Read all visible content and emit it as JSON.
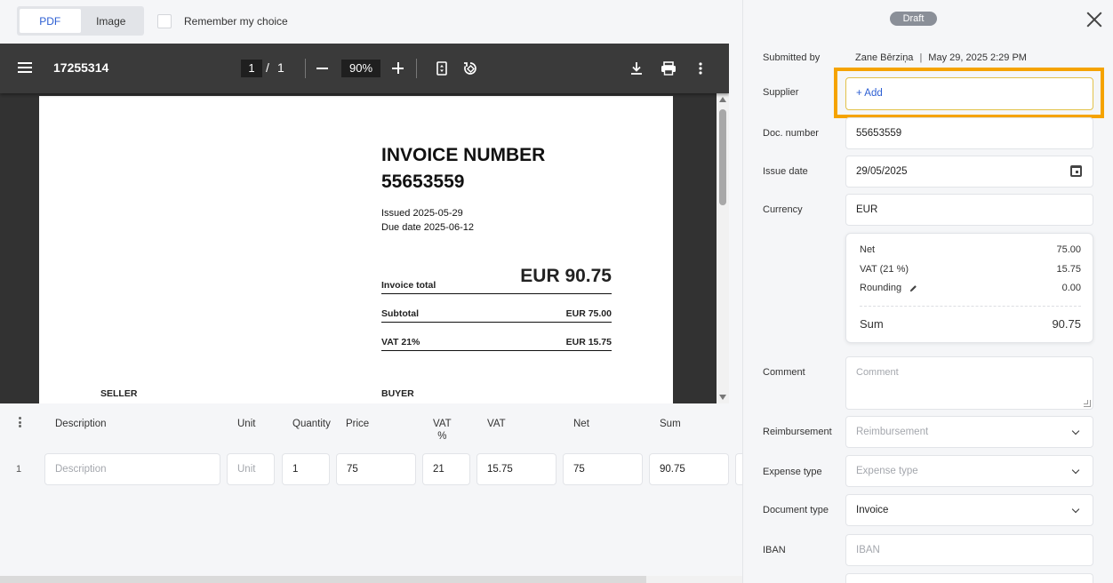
{
  "view_toggle": {
    "pdf": "PDF",
    "image": "Image"
  },
  "remember_choice": "Remember my choice",
  "viewer": {
    "doc_name": "17255314",
    "page_current": "1",
    "page_separator": "/",
    "page_total": "1",
    "zoom": "90%"
  },
  "invoice_page": {
    "title_line1": "INVOICE NUMBER",
    "title_line2": "55653559",
    "issued": "Issued 2025-05-29",
    "due": "Due date 2025-06-12",
    "invoice_total_label": "Invoice total",
    "invoice_total_value": "EUR 90.75",
    "subtotal_label": "Subtotal",
    "subtotal_value": "EUR 75.00",
    "vat_label": "VAT 21%",
    "vat_value": "EUR 15.75",
    "seller_label": "SELLER",
    "buyer_label": "BUYER"
  },
  "items": {
    "headers": {
      "description": "Description",
      "unit": "Unit",
      "quantity": "Quantity",
      "price": "Price",
      "vat_pct_1": "VAT",
      "vat_pct_2": "%",
      "vat": "VAT",
      "net": "Net",
      "sum": "Sum"
    },
    "rows": [
      {
        "num": "1",
        "description_placeholder": "Description",
        "unit_placeholder": "Unit",
        "quantity": "1",
        "price": "75",
        "vat_pct": "21",
        "vat": "15.75",
        "net": "75",
        "sum": "90.75"
      }
    ]
  },
  "panel": {
    "status": "Draft",
    "submitted_by_label": "Submitted by",
    "submitted_by_name": "Zane Bērziņa",
    "submitted_sep": "|",
    "submitted_date": "May 29, 2025 2:29 PM",
    "supplier_label": "Supplier",
    "supplier_add": "+ Add",
    "doc_number_label": "Doc. number",
    "doc_number": "55653559",
    "issue_date_label": "Issue date",
    "issue_date": "29/05/2025",
    "currency_label": "Currency",
    "currency": "EUR",
    "totals": {
      "net_label": "Net",
      "net": "75.00",
      "vat_label": "VAT (21 %)",
      "vat": "15.75",
      "rounding_label": "Rounding",
      "rounding": "0.00",
      "sum_label": "Sum",
      "sum": "90.75"
    },
    "comment_label": "Comment",
    "comment_placeholder": "Comment",
    "reimbursement_label": "Reimbursement",
    "reimbursement_placeholder": "Reimbursement",
    "expense_type_label": "Expense type",
    "expense_type_placeholder": "Expense type",
    "document_type_label": "Document type",
    "document_type": "Invoice",
    "iban_label": "IBAN",
    "iban_placeholder": "IBAN"
  },
  "colors": {
    "accent": "#2d5fd3",
    "highlight": "#f5a300",
    "badge": "#8a8f98"
  }
}
